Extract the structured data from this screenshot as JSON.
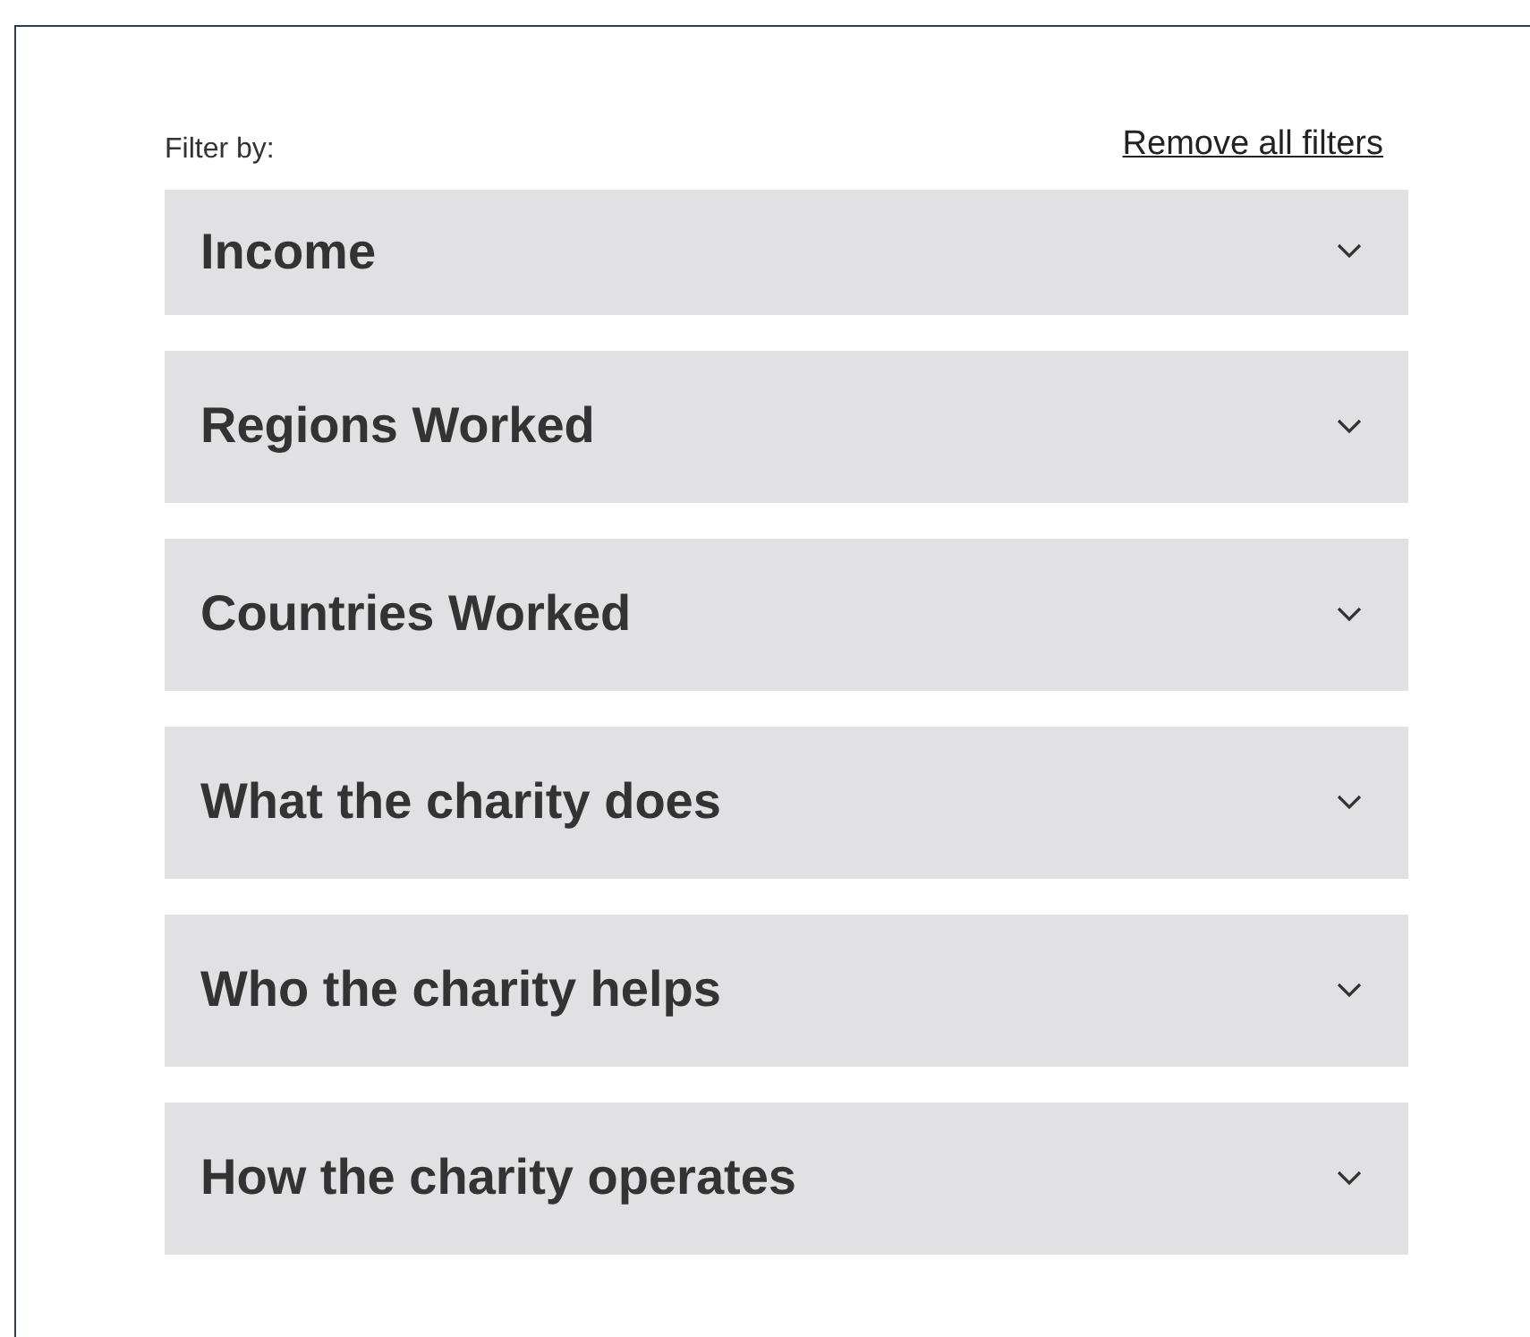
{
  "filter_label": "Filter by:",
  "remove_link": "Remove all filters",
  "sections": [
    {
      "title": "Income",
      "expanded": false
    },
    {
      "title": "Regions Worked",
      "expanded": false
    },
    {
      "title": "Countries Worked",
      "expanded": false
    },
    {
      "title": "What the charity does",
      "expanded": false
    },
    {
      "title": "Who the charity helps",
      "expanded": false
    },
    {
      "title": "How the charity operates",
      "expanded": false
    }
  ]
}
